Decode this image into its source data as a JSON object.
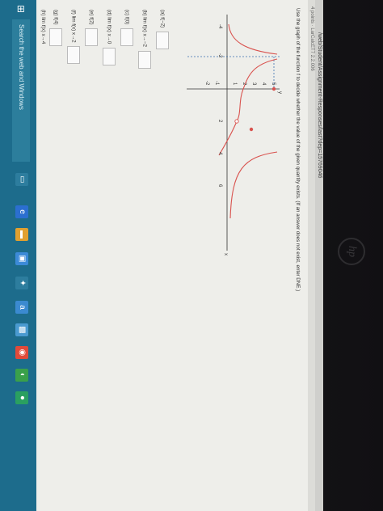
{
  "browser": {
    "url": "/web/Student/Assignment-Responses/last?dep=15769046",
    "tab_text": "4 points · LarCalcET7 2.2.006"
  },
  "instructions": "Use the graph of the function f to decide whether the value of the given quantity exists. (If an answer does not exist, enter DNE.)",
  "graph": {
    "x_ticks": [
      "-4",
      "-2",
      "2",
      "4",
      "6"
    ],
    "y_ticks": [
      "5",
      "4",
      "3",
      "2",
      "1",
      "-1",
      "-2"
    ],
    "x_label": "x",
    "y_label": "y"
  },
  "questions": [
    {
      "label": "(a)",
      "expr": "f(−2)"
    },
    {
      "label": "(b)",
      "expr": "lim f(x)  x→−2"
    },
    {
      "label": "(c)",
      "expr": "f(0)"
    },
    {
      "label": "(d)",
      "expr": "lim f(x)  x→0"
    },
    {
      "label": "(e)",
      "expr": "f(2)"
    },
    {
      "label": "(f)",
      "expr": "lim f(x)  x→2"
    },
    {
      "label": "(g)",
      "expr": "f(4)"
    },
    {
      "label": "(h)",
      "expr": "lim f(x)  x→4"
    }
  ],
  "taskbar": {
    "search_placeholder": "Search the web and Windows"
  },
  "brand": {
    "laptop_logo": "hp"
  },
  "colors": {
    "curve": "#d9534f",
    "dashed": "#3a6fb0",
    "taskbar": "#1d6c8c"
  }
}
